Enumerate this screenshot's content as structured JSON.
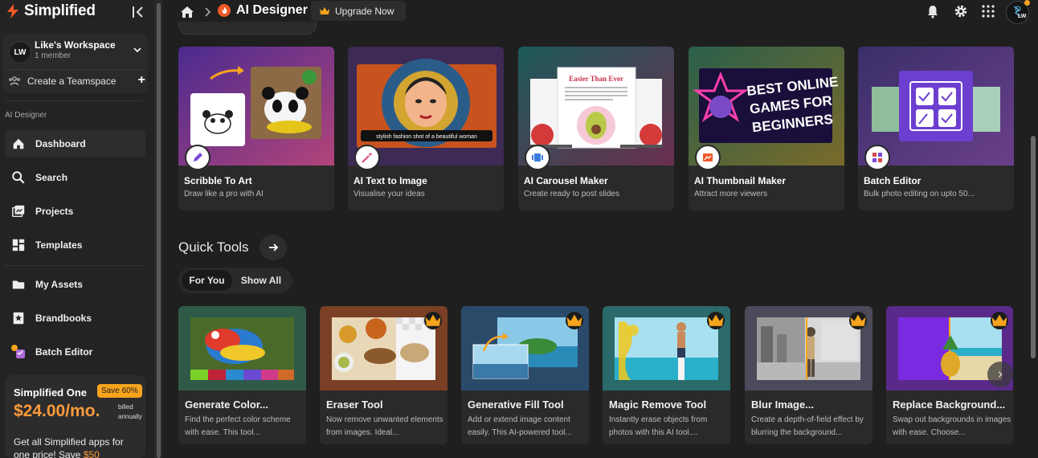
{
  "brand": {
    "name": "Simplified"
  },
  "workspace": {
    "initials": "LW",
    "name": "Like's Workspace",
    "members": "1 member",
    "create_team": "Create a Teamspace"
  },
  "sidebar": {
    "section": "AI Designer",
    "items": [
      {
        "label": "Dashboard",
        "icon": "dashboard-icon",
        "active": true
      },
      {
        "label": "Search",
        "icon": "search-icon"
      },
      {
        "label": "Projects",
        "icon": "projects-icon"
      },
      {
        "label": "Templates",
        "icon": "templates-icon"
      },
      {
        "label": "My Assets",
        "icon": "folder-icon"
      },
      {
        "label": "Brandbooks",
        "icon": "brandbook-icon"
      },
      {
        "label": "Batch Editor",
        "icon": "batch-editor-icon"
      }
    ]
  },
  "promo": {
    "title": "Simplified One",
    "badge": "Save 60%",
    "price": "$24.00/mo.",
    "billed": "billed annually",
    "desc": "Get all Simplified apps for one price! Save",
    "highlight": "$50"
  },
  "topbar": {
    "app_title": "AI Designer",
    "upgrade": "Upgrade Now",
    "user_initials": "LW"
  },
  "featured": [
    {
      "title": "Scribble To Art",
      "sub": "Draw like a pro with AI",
      "icon": "pencil-icon"
    },
    {
      "title": "AI Text to Image",
      "sub": "Visualise your ideas",
      "icon": "magic-wand-icon",
      "caption": "stylish fashion shot of a beautiful woman"
    },
    {
      "title": "AI Carousel Maker",
      "sub": "Create ready to post slides",
      "icon": "carousel-icon",
      "slide_title": "Easier Than Ever"
    },
    {
      "title": "AI Thumbnail Maker",
      "sub": "Attract more viewers",
      "icon": "thumbnail-icon",
      "thumb_text": [
        "BEST ONLINE",
        "GAMES FOR",
        "BEGINNERS"
      ]
    },
    {
      "title": "Batch Editor",
      "sub": "Bulk photo editing on upto 50...",
      "icon": "batch-icon"
    }
  ],
  "quick_tools": {
    "title": "Quick Tools",
    "tabs": [
      {
        "label": "For You",
        "active": true
      },
      {
        "label": "Show All"
      }
    ],
    "items": [
      {
        "title": "Generate Color...",
        "desc": "Find the perfect color scheme with ease. This tool..."
      },
      {
        "title": "Eraser Tool",
        "desc": "Now remove unwanted elements from images. Ideal..."
      },
      {
        "title": "Generative Fill Tool",
        "desc": "Add or extend image content easily. This AI-powered tool..."
      },
      {
        "title": "Magic Remove Tool",
        "desc": "Instantly erase objects from photos with this AI tool...."
      },
      {
        "title": "Blur Image...",
        "desc": "Create a depth-of-field effect by blurring the background..."
      },
      {
        "title": "Replace Background...",
        "desc": "Swap out backgrounds in images with ease. Choose..."
      }
    ]
  },
  "colors": {
    "accent": "#f7a41d",
    "price": "#ff9a3c",
    "brand_orange": "#f05a28"
  }
}
